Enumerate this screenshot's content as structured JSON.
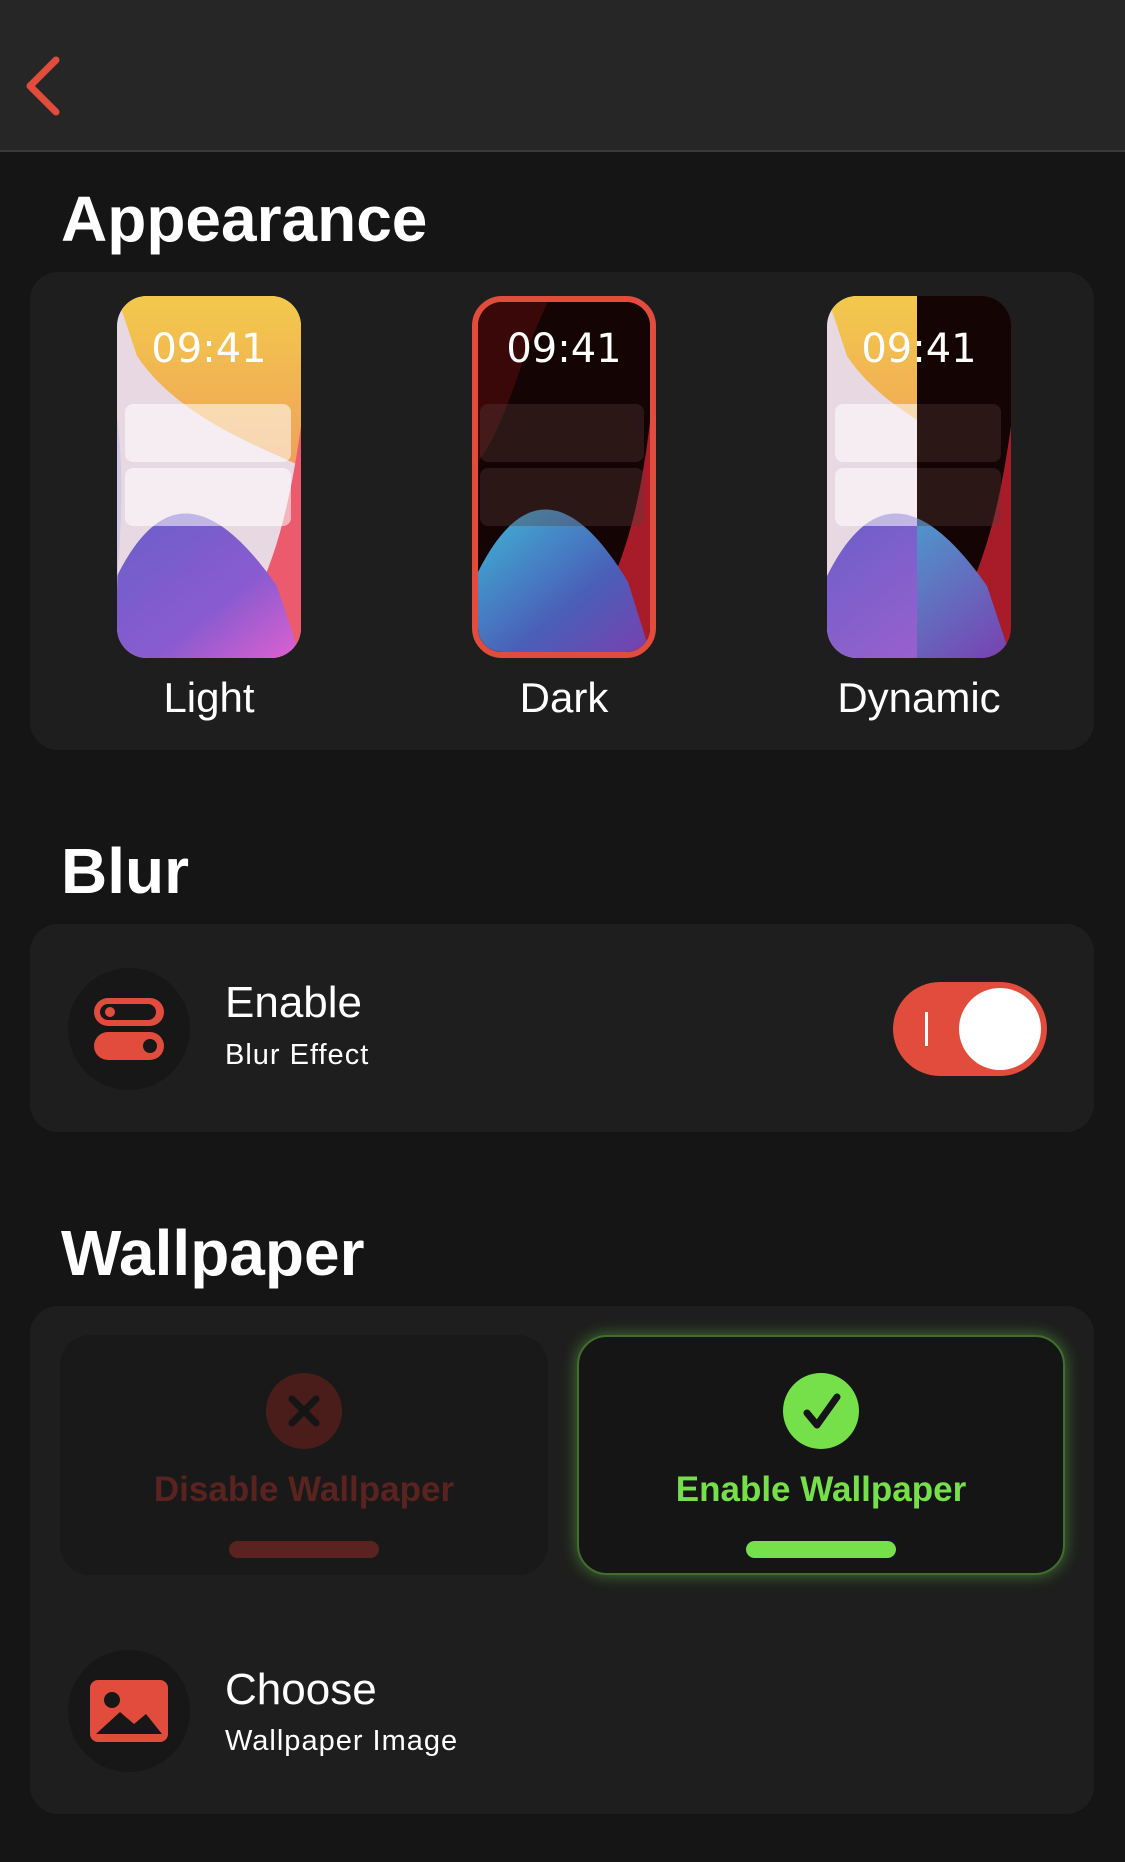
{
  "nav": {
    "back_icon": "chevron-left-icon",
    "accent": "#e14c3c"
  },
  "appearance": {
    "title": "Appearance",
    "options": [
      {
        "label": "Light",
        "time": "09:41",
        "selected": false
      },
      {
        "label": "Dark",
        "time": "09:41",
        "selected": true
      },
      {
        "label": "Dynamic",
        "time": "09:41",
        "selected": false
      }
    ]
  },
  "blur": {
    "title": "Blur",
    "row_title": "Enable",
    "row_subtitle": "Blur Effect",
    "icon": "toggles-icon",
    "enabled": true
  },
  "wallpaper": {
    "title": "Wallpaper",
    "disable_label": "Disable Wallpaper",
    "enable_label": "Enable Wallpaper",
    "selected": "enable",
    "choose_title": "Choose",
    "choose_subtitle": "Wallpaper Image",
    "choose_icon": "image-icon",
    "colors": {
      "enable": "#76e04b",
      "disable": "#5a2320"
    }
  }
}
